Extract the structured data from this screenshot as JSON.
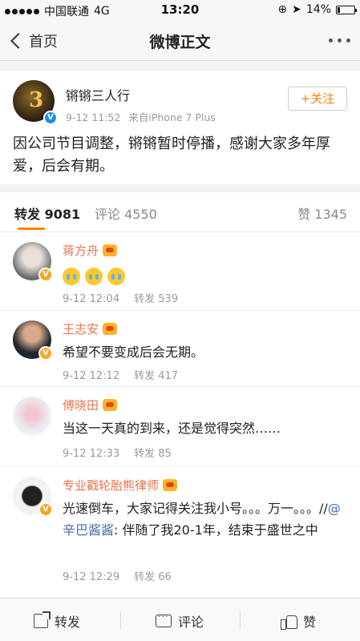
{
  "status_bar": {
    "carrier": "中国联通",
    "network": "4G",
    "time": "13:20",
    "battery": "14%",
    "battery_level": 0.14
  },
  "nav": {
    "back_label": "首页",
    "title": "微博正文"
  },
  "post": {
    "author": "锵锵三人行",
    "date": "9-12 11:52",
    "source": "来自iPhone 7 Plus",
    "follow_label": "+关注",
    "text": "因公司节目调整，锵锵暂时停播，感谢大家多年厚爱，后会有期。"
  },
  "tabs": {
    "repost": "转发 9081",
    "comment": "评论 4550",
    "like": "赞 1345",
    "accent": "#ff8200"
  },
  "reposts": [
    {
      "name": "蒋方舟",
      "content": "",
      "emoji_count": 3,
      "time": "9-12 12:04",
      "repost_count": "转发 539"
    },
    {
      "name": "王志安",
      "content": "希望不要变成后会无期。",
      "time": "9-12 12:12",
      "repost_count": "转发 417"
    },
    {
      "name": "傅晓田",
      "content": "当这一天真的到来，还是觉得突然……",
      "time": "9-12 12:33",
      "repost_count": "转发 85"
    },
    {
      "name": "专业戳轮胎熊律师",
      "content_pre": "光速倒车，大家记得关注我小号。。。万一。。。//",
      "mention": "@辛巴酱酱",
      "content_post": ": 伴随了我20-1年，结束于盛世之中",
      "time": "9-12 12:29",
      "repost_count": "转发 66"
    }
  ],
  "bottom_bar": {
    "repost": "转发",
    "comment": "评论",
    "like": "赞"
  }
}
